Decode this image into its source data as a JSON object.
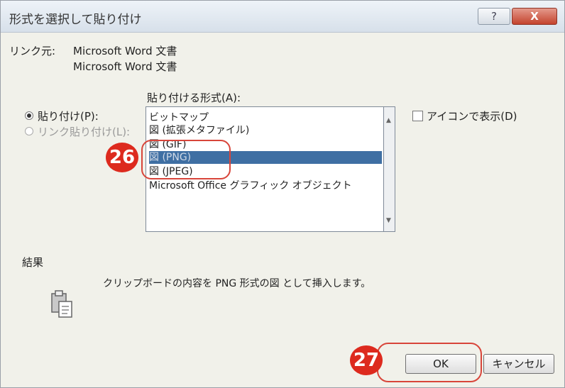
{
  "dialog": {
    "title": "形式を選択して貼り付け",
    "help_label": "?",
    "close_label": "X"
  },
  "source": {
    "label": "リンク元:",
    "line1": "Microsoft Word 文書",
    "line2": "Microsoft Word 文書"
  },
  "options": {
    "paste_label": "貼り付け(P):",
    "paste_link_label": "リンク貼り付け(L):",
    "selected": "paste"
  },
  "format": {
    "label": "貼り付ける形式(A):",
    "items": [
      "ビットマップ",
      "図 (拡張メタファイル)",
      "図 (GIF)",
      "図 (PNG)",
      "図 (JPEG)",
      "Microsoft Office グラフィック オブジェクト"
    ],
    "selected_index": 3
  },
  "display_as_icon": {
    "label": "アイコンで表示(D)",
    "checked": false
  },
  "result": {
    "heading": "結果",
    "description": "クリップボードの内容を PNG 形式の図 として挿入します。"
  },
  "buttons": {
    "ok": "OK",
    "cancel": "キャンセル"
  },
  "markers": {
    "step1": "26",
    "step2": "27"
  }
}
